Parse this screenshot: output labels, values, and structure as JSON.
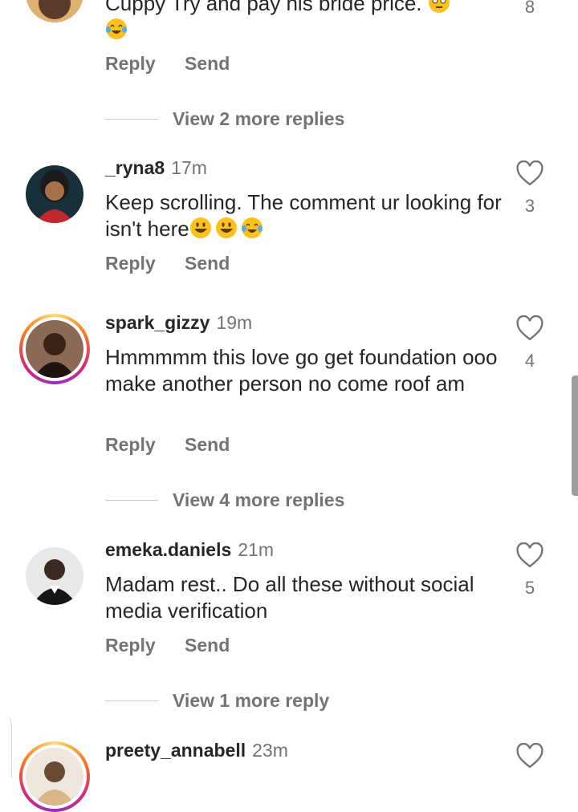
{
  "comments": [
    {
      "text_line1": "Cuppy Try and pay his bride price.",
      "like_count": "8",
      "reply_label": "Reply",
      "send_label": "Send",
      "view_more": "View 2 more replies"
    },
    {
      "username": "_ryna8",
      "time": "17m",
      "text": "Keep scrolling. The comment ur looking  for isn't here",
      "like_count": "3",
      "reply_label": "Reply",
      "send_label": "Send"
    },
    {
      "username": "spark_gizzy",
      "time": "19m",
      "text": "Hmmmmm this love go get foundation ooo  make another person no come roof am",
      "like_count": "4",
      "reply_label": "Reply",
      "send_label": "Send",
      "view_more": "View 4 more replies"
    },
    {
      "username": "emeka.daniels",
      "time": "21m",
      "text": "Madam rest.. Do all these without social media verification",
      "like_count": "5",
      "reply_label": "Reply",
      "send_label": "Send",
      "view_more": "View 1 more reply"
    },
    {
      "username": "preety_annabell",
      "time": "23m"
    }
  ],
  "colors": {
    "text": "#262626",
    "muted": "#737373",
    "divider": "#c7c7c7"
  }
}
